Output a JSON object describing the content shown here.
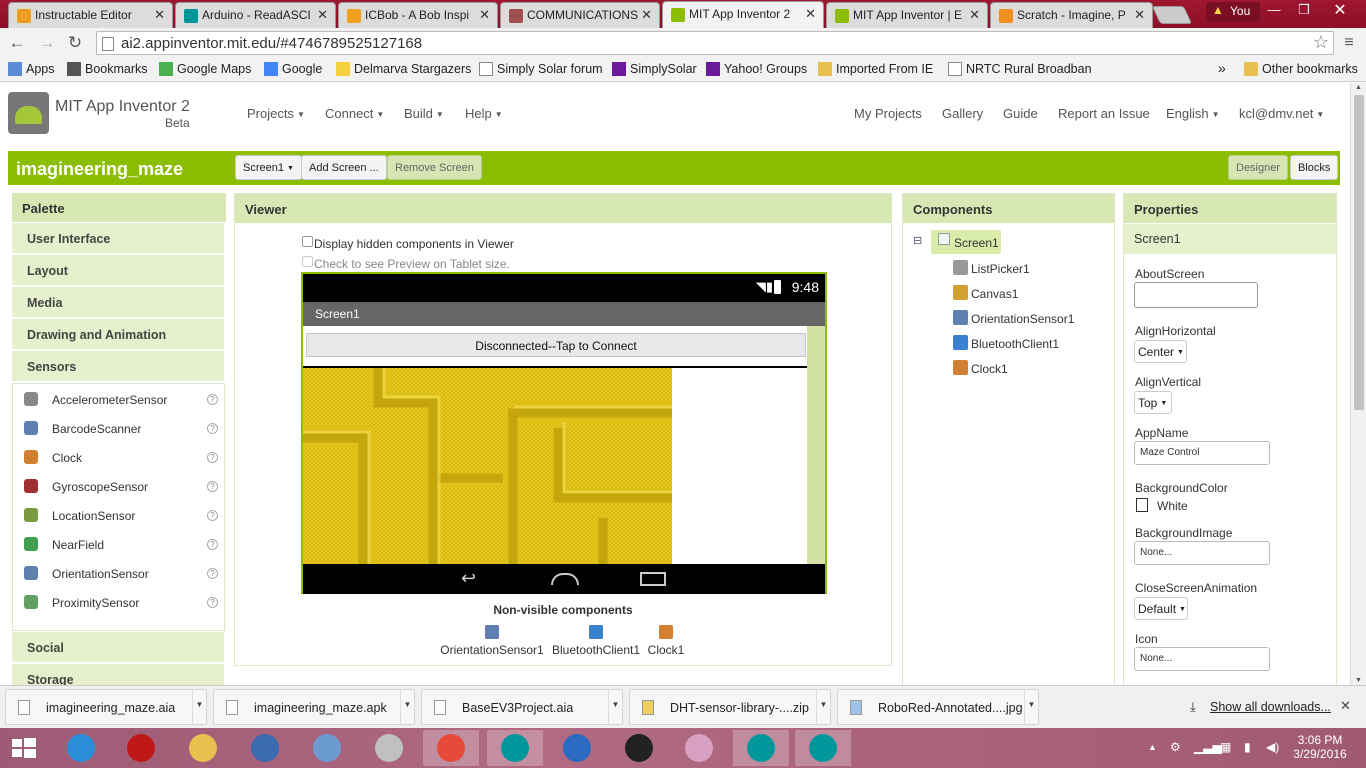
{
  "browser": {
    "tabs": [
      {
        "title": "Instructable Editor",
        "color": "#f0a020"
      },
      {
        "title": "Arduino - ReadASCI",
        "color": "#00979c"
      },
      {
        "title": "ICBob - A Bob Inspi",
        "color": "#f0a020"
      },
      {
        "title": "COMMUNICATIONS",
        "color": "#a05050"
      },
      {
        "title": "MIT App Inventor 2",
        "color": "#8bbd00",
        "active": true
      },
      {
        "title": "MIT App Inventor | E",
        "color": "#8bbd00"
      },
      {
        "title": "Scratch - Imagine, P",
        "color": "#f09020"
      }
    ],
    "user_label": "You",
    "url": "ai2.appinventor.mit.edu/#4746789525127168",
    "bookmarks": [
      {
        "label": "Apps",
        "icon": "apps-grid-icon"
      },
      {
        "label": "Bookmarks",
        "icon": "star-icon"
      },
      {
        "label": "Google Maps",
        "icon": "maps-icon"
      },
      {
        "label": "Google",
        "icon": "google-icon"
      },
      {
        "label": "Delmarva Stargazers",
        "icon": "star-burst-icon"
      },
      {
        "label": "Simply Solar forum",
        "icon": "page-icon"
      },
      {
        "label": "SimplySolar",
        "icon": "yahoo-icon"
      },
      {
        "label": "Yahoo! Groups",
        "icon": "yahoo-icon"
      },
      {
        "label": "Imported From IE",
        "icon": "folder-icon"
      },
      {
        "label": "NRTC Rural Broadban",
        "icon": "page-icon"
      }
    ],
    "bookmarks_overflow": "»",
    "other_bookmarks": "Other bookmarks"
  },
  "header": {
    "title": "MIT App Inventor 2",
    "subtitle": "Beta",
    "menus": [
      "Projects",
      "Connect",
      "Build",
      "Help"
    ],
    "right_links": [
      "My Projects",
      "Gallery",
      "Guide",
      "Report an Issue"
    ],
    "language": "English",
    "account": "kcl@dmv.net"
  },
  "project": {
    "name": "imagineering_maze",
    "screen_select": "Screen1",
    "add_screen": "Add Screen ...",
    "remove_screen": "Remove Screen",
    "designer": "Designer",
    "blocks": "Blocks"
  },
  "palette": {
    "title": "Palette",
    "categories_top": [
      "User Interface",
      "Layout",
      "Media",
      "Drawing and Animation",
      "Sensors"
    ],
    "sensors": [
      {
        "label": "AccelerometerSensor",
        "color": "#888"
      },
      {
        "label": "BarcodeScanner",
        "color": "#5a7fb0"
      },
      {
        "label": "Clock",
        "color": "#d08030"
      },
      {
        "label": "GyroscopeSensor",
        "color": "#a03030"
      },
      {
        "label": "LocationSensor",
        "color": "#7a9a40"
      },
      {
        "label": "NearField",
        "color": "#40a050"
      },
      {
        "label": "OrientationSensor",
        "color": "#6080b0"
      },
      {
        "label": "ProximitySensor",
        "color": "#60a060"
      }
    ],
    "help_glyph": "?",
    "categories_bottom": [
      "Social",
      "Storage"
    ]
  },
  "viewer": {
    "title": "Viewer",
    "hidden_components": "Display hidden components in Viewer",
    "tablet_preview": "Check to see Preview on Tablet size.",
    "phone_time": "9:48",
    "screen_title": "Screen1",
    "connect_button": "Disconnected--Tap to Connect",
    "nonvisible_title": "Non-visible components",
    "nonvisible": [
      {
        "label": "OrientationSensor1",
        "color": "#6080b0"
      },
      {
        "label": "BluetoothClient1",
        "color": "#3a80d0"
      },
      {
        "label": "Clock1",
        "color": "#d08030"
      }
    ]
  },
  "components": {
    "title": "Components",
    "root": "Screen1",
    "collapse_glyph": "⊟",
    "children": [
      {
        "label": "ListPicker1",
        "color": "#999"
      },
      {
        "label": "Canvas1",
        "color": "#d0a030"
      },
      {
        "label": "OrientationSensor1",
        "color": "#6080b0"
      },
      {
        "label": "BluetoothClient1",
        "color": "#3a80d0"
      },
      {
        "label": "Clock1",
        "color": "#d08030"
      }
    ]
  },
  "properties": {
    "title": "Properties",
    "component": "Screen1",
    "about_screen_label": "AboutScreen",
    "about_screen_value": "",
    "align_horizontal_label": "AlignHorizontal",
    "align_horizontal_value": "Center",
    "align_vertical_label": "AlignVertical",
    "align_vertical_value": "Top",
    "app_name_label": "AppName",
    "app_name_value": "Maze Control",
    "background_color_label": "BackgroundColor",
    "background_color_value": "White",
    "background_image_label": "BackgroundImage",
    "background_image_value": "None...",
    "close_anim_label": "CloseScreenAnimation",
    "close_anim_value": "Default",
    "icon_label": "Icon",
    "icon_value": "None..."
  },
  "downloads": {
    "items": [
      "imagineering_maze.aia",
      "imagineering_maze.apk",
      "BaseEV3Project.aia",
      "DHT-sensor-library-....zip",
      "RoboRed-Annotated....jpg"
    ],
    "show_all": "Show all downloads...",
    "close_glyph": "✕"
  },
  "taskbar": {
    "apps": [
      {
        "name": "internet-explorer-icon",
        "color": "#2a8fd8"
      },
      {
        "name": "power-app-icon",
        "color": "#c01818"
      },
      {
        "name": "file-explorer-icon",
        "color": "#e8c050"
      },
      {
        "name": "thunderbird-icon",
        "color": "#3a6ab0"
      },
      {
        "name": "notepad-app-icon",
        "color": "#6a9ad0"
      },
      {
        "name": "calculator-icon",
        "color": "#c0c0c0"
      },
      {
        "name": "chrome-icon",
        "color": "#e84a3a"
      },
      {
        "name": "arduino-icon",
        "color": "#00979c"
      },
      {
        "name": "c-app-icon",
        "color": "#2a6ac0"
      },
      {
        "name": "p-app-icon",
        "color": "#222222"
      },
      {
        "name": "paint-icon",
        "color": "#d8a0c0"
      },
      {
        "name": "arduino-icon-2",
        "color": "#00979c"
      },
      {
        "name": "arduino-icon-3",
        "color": "#00979c"
      }
    ],
    "time": "3:06 PM",
    "date": "3/29/2016"
  }
}
